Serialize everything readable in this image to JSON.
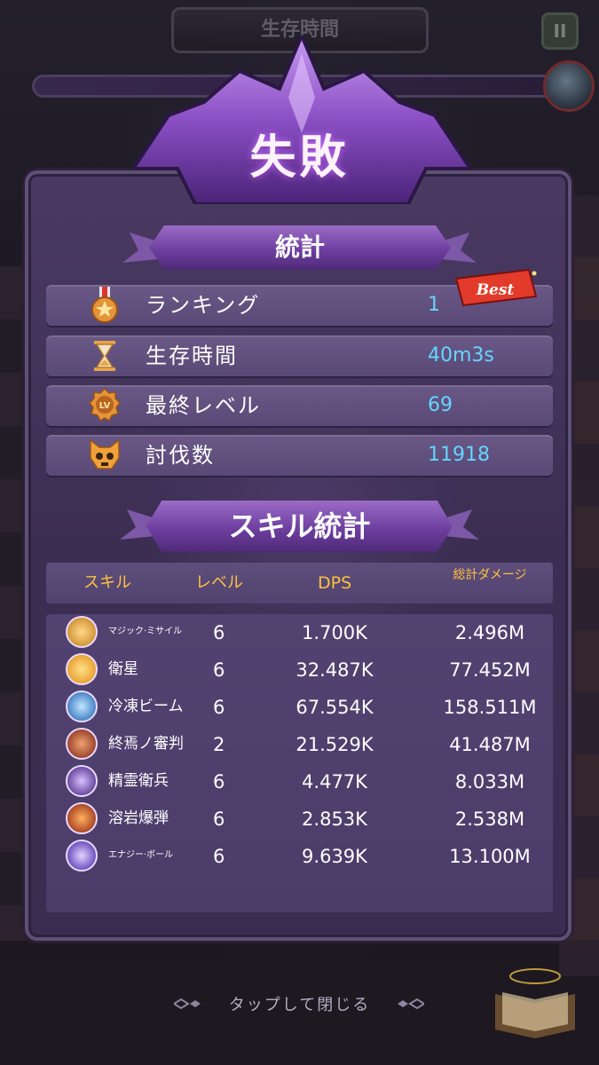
{
  "hud": {
    "title": "生存時間",
    "pause_label": "II"
  },
  "dialog": {
    "title": "失敗",
    "stats_heading": "統計",
    "best_badge": "Best",
    "stats": [
      {
        "icon": "medal-icon",
        "label": "ランキング",
        "value": "1"
      },
      {
        "icon": "hourglass-icon",
        "label": "生存時間",
        "value": "40m3s"
      },
      {
        "icon": "level-badge-icon",
        "label": "最終レベル",
        "value": "69"
      },
      {
        "icon": "skull-icon",
        "label": "討伐数",
        "value": "11918"
      }
    ],
    "level_badge_text": "LV",
    "skills_heading": "スキル統計",
    "table_headers": {
      "skill": "スキル",
      "level": "レベル",
      "dps": "DPS",
      "damage": "総計ダメージ"
    },
    "skills": [
      {
        "icon": "magic-missile-icon",
        "name": "マジック·ミサイル",
        "level": "6",
        "dps": "1.700K",
        "damage": "2.496M",
        "color": "#f0b030"
      },
      {
        "icon": "satellite-icon",
        "name": "衛星",
        "level": "6",
        "dps": "32.487K",
        "damage": "77.452M",
        "color": "#f5a623"
      },
      {
        "icon": "frost-beam-icon",
        "name": "冷凍ビーム",
        "level": "6",
        "dps": "67.554K",
        "damage": "158.511M",
        "color": "#2d7fd6"
      },
      {
        "icon": "final-judgment-icon",
        "name": "終焉ノ審判",
        "level": "2",
        "dps": "21.529K",
        "damage": "41.487M",
        "color": "#b3432b"
      },
      {
        "icon": "spirit-guard-icon",
        "name": "精霊衛兵",
        "level": "6",
        "dps": "4.477K",
        "damage": "8.033M",
        "color": "#6a3aa8"
      },
      {
        "icon": "lava-bomb-icon",
        "name": "溶岩爆弾",
        "level": "6",
        "dps": "2.853K",
        "damage": "2.538M",
        "color": "#c0401f"
      },
      {
        "icon": "energy-ball-icon",
        "name": "エナジー·ボール",
        "level": "6",
        "dps": "9.639K",
        "damage": "13.100M",
        "color": "#5a3fd0"
      }
    ],
    "close_hint": "タップして閉じる"
  }
}
